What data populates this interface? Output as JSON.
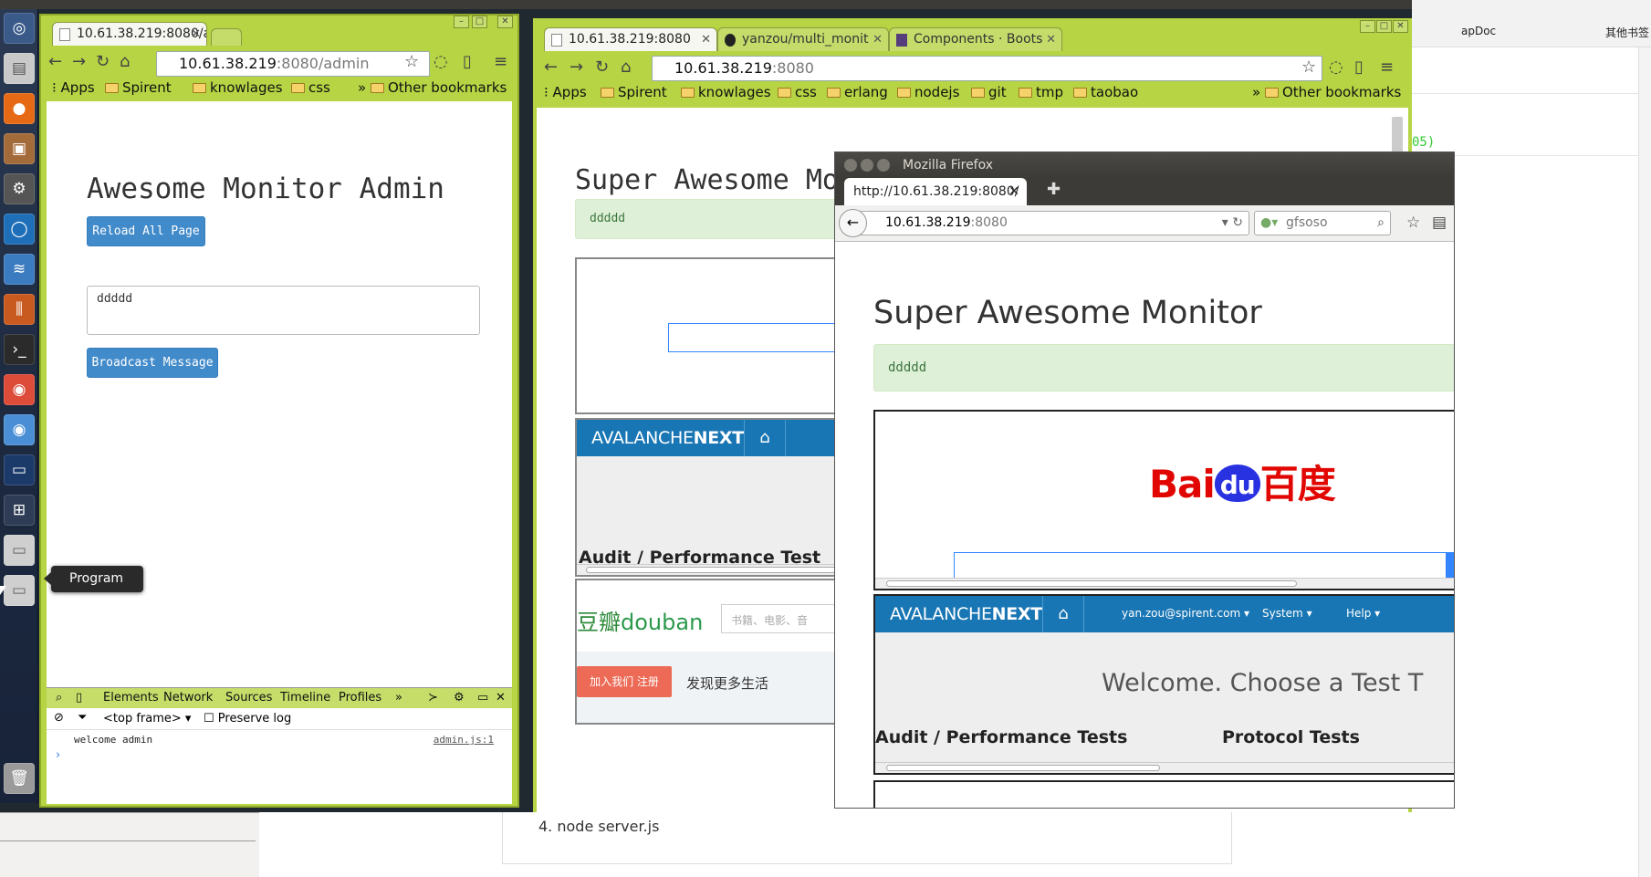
{
  "desktop": {
    "launcher_tooltip": "Program"
  },
  "admin_window": {
    "tab_title": "10.61.38.219:8080/a",
    "url_host": "10.61.38.219",
    "url_path": ":8080/admin",
    "bookmarks": [
      "Apps",
      "Spirent",
      "knowlages",
      "css"
    ],
    "other_bookmarks": "Other bookmarks",
    "page_title": "Awesome Monitor Admin",
    "reload_button": "Reload All Page",
    "message_value": "ddddd",
    "broadcast_button": "Broadcast Message",
    "devtools": {
      "tabs": [
        "Elements",
        "Network",
        "Sources",
        "Timeline",
        "Profiles"
      ],
      "frame_select": "<top frame>",
      "preserve_log": "Preserve log",
      "log_message": "welcome admin",
      "log_source": "admin.js:1"
    }
  },
  "monitor_window": {
    "tabs": [
      {
        "title": "10.61.38.219:8080"
      },
      {
        "title": "yanzou/multi_monit"
      },
      {
        "title": "Components · Boots"
      }
    ],
    "url_host": "10.61.38.219",
    "url_path": ":8080",
    "bookmarks": [
      "Apps",
      "Spirent",
      "knowlages",
      "css",
      "erlang",
      "nodejs",
      "git",
      "tmp",
      "taobao"
    ],
    "other_bookmarks": "Other bookmarks",
    "page_title": "Super Awesome Mo",
    "alert": "ddddd",
    "avalanche_brand_a": "AVALANCHE",
    "avalanche_brand_b": "NEXT",
    "audit_heading": "Audit / Performance Test",
    "douban_logo_cn": "豆瓣",
    "douban_logo_en": "douban",
    "douban_search_placeholder": "书籍、电影、音",
    "douban_join_button": "加入我们 注册",
    "douban_discover": "发现更多生活"
  },
  "firefox_window": {
    "title": "Mozilla Firefox",
    "tab_title": "http://10.61.38.219:8080/",
    "url_host": "10.61.38.219",
    "url_path": ":8080",
    "search_value": "gfsoso",
    "page_title": "Super Awesome Monitor",
    "alert": "ddddd",
    "baidu_logo_a": "Bai",
    "baidu_logo_paw": "du",
    "baidu_logo_cn": "百度",
    "avalanche_brand_a": "AVALANCHE",
    "avalanche_brand_b": "NEXT",
    "avalanche_user": "yan.zou@spirent.com ▾",
    "avalanche_system": "System ▾",
    "avalanche_help": "Help ▾",
    "welcome_text": "Welcome. Choose a Test T",
    "audit_heading": "Audit / Performance Tests",
    "protocol_heading": "Protocol Tests"
  },
  "background_right": {
    "doc_label": "apDoc",
    "other_label": "其他书签",
    "green_text": "05)"
  },
  "background_bottom": {
    "list_number": "4.",
    "list_text": "node server.js"
  }
}
